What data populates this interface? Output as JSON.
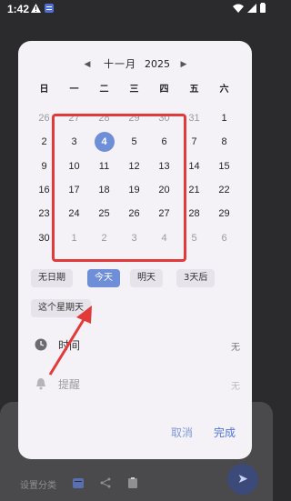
{
  "status_bar": {
    "time": "1:42"
  },
  "calendar": {
    "month": "十一月",
    "year": "2025",
    "weekdays": [
      "日",
      "一",
      "二",
      "三",
      "四",
      "五",
      "六"
    ],
    "weeks": [
      [
        {
          "d": "26",
          "m": true
        },
        {
          "d": "27",
          "m": true
        },
        {
          "d": "28",
          "m": true
        },
        {
          "d": "29",
          "m": true
        },
        {
          "d": "30",
          "m": true
        },
        {
          "d": "31",
          "m": true
        },
        {
          "d": "1",
          "m": false
        }
      ],
      [
        {
          "d": "2",
          "m": false
        },
        {
          "d": "3",
          "m": false
        },
        {
          "d": "4",
          "m": false,
          "sel": true
        },
        {
          "d": "5",
          "m": false
        },
        {
          "d": "6",
          "m": false
        },
        {
          "d": "7",
          "m": false
        },
        {
          "d": "8",
          "m": false
        }
      ],
      [
        {
          "d": "9",
          "m": false
        },
        {
          "d": "10",
          "m": false
        },
        {
          "d": "11",
          "m": false
        },
        {
          "d": "12",
          "m": false
        },
        {
          "d": "13",
          "m": false
        },
        {
          "d": "14",
          "m": false
        },
        {
          "d": "15",
          "m": false
        }
      ],
      [
        {
          "d": "16",
          "m": false
        },
        {
          "d": "17",
          "m": false
        },
        {
          "d": "18",
          "m": false
        },
        {
          "d": "19",
          "m": false
        },
        {
          "d": "20",
          "m": false
        },
        {
          "d": "21",
          "m": false
        },
        {
          "d": "22",
          "m": false
        }
      ],
      [
        {
          "d": "23",
          "m": false
        },
        {
          "d": "24",
          "m": false
        },
        {
          "d": "25",
          "m": false
        },
        {
          "d": "26",
          "m": false
        },
        {
          "d": "27",
          "m": false
        },
        {
          "d": "28",
          "m": false
        },
        {
          "d": "29",
          "m": false
        }
      ],
      [
        {
          "d": "30",
          "m": false
        },
        {
          "d": "1",
          "m": true
        },
        {
          "d": "2",
          "m": true
        },
        {
          "d": "3",
          "m": true
        },
        {
          "d": "4",
          "m": true
        },
        {
          "d": "5",
          "m": true
        },
        {
          "d": "6",
          "m": true
        }
      ]
    ]
  },
  "quick_chips": {
    "no_date": "无日期",
    "today": "今天",
    "tomorrow": "明天",
    "in_3_days": "3天后",
    "this_sunday": "这个星期天"
  },
  "time_row": {
    "label": "时间",
    "value": "无"
  },
  "reminder_row": {
    "label": "提醒",
    "value": "无"
  },
  "footer": {
    "cancel": "取消",
    "done": "完成"
  },
  "background": {
    "bottom_label": "设置分类"
  },
  "colors": {
    "accent": "#6e8ed8",
    "annotation": "#e23a3a",
    "dialog_bg": "#f4f2f6"
  }
}
